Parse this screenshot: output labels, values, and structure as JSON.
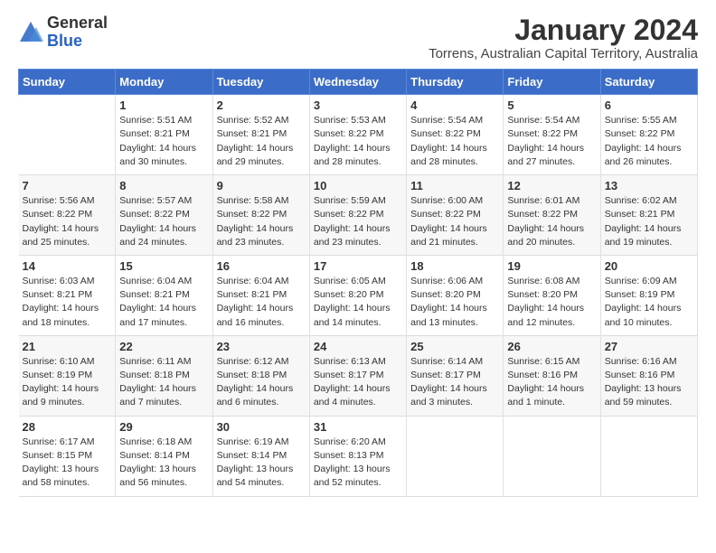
{
  "logo": {
    "general": "General",
    "blue": "Blue"
  },
  "header": {
    "title": "January 2024",
    "subtitle": "Torrens, Australian Capital Territory, Australia"
  },
  "calendar": {
    "days_of_week": [
      "Sunday",
      "Monday",
      "Tuesday",
      "Wednesday",
      "Thursday",
      "Friday",
      "Saturday"
    ],
    "weeks": [
      [
        {
          "day": "",
          "info": ""
        },
        {
          "day": "1",
          "info": "Sunrise: 5:51 AM\nSunset: 8:21 PM\nDaylight: 14 hours\nand 30 minutes."
        },
        {
          "day": "2",
          "info": "Sunrise: 5:52 AM\nSunset: 8:21 PM\nDaylight: 14 hours\nand 29 minutes."
        },
        {
          "day": "3",
          "info": "Sunrise: 5:53 AM\nSunset: 8:22 PM\nDaylight: 14 hours\nand 28 minutes."
        },
        {
          "day": "4",
          "info": "Sunrise: 5:54 AM\nSunset: 8:22 PM\nDaylight: 14 hours\nand 28 minutes."
        },
        {
          "day": "5",
          "info": "Sunrise: 5:54 AM\nSunset: 8:22 PM\nDaylight: 14 hours\nand 27 minutes."
        },
        {
          "day": "6",
          "info": "Sunrise: 5:55 AM\nSunset: 8:22 PM\nDaylight: 14 hours\nand 26 minutes."
        }
      ],
      [
        {
          "day": "7",
          "info": "Sunrise: 5:56 AM\nSunset: 8:22 PM\nDaylight: 14 hours\nand 25 minutes."
        },
        {
          "day": "8",
          "info": "Sunrise: 5:57 AM\nSunset: 8:22 PM\nDaylight: 14 hours\nand 24 minutes."
        },
        {
          "day": "9",
          "info": "Sunrise: 5:58 AM\nSunset: 8:22 PM\nDaylight: 14 hours\nand 23 minutes."
        },
        {
          "day": "10",
          "info": "Sunrise: 5:59 AM\nSunset: 8:22 PM\nDaylight: 14 hours\nand 23 minutes."
        },
        {
          "day": "11",
          "info": "Sunrise: 6:00 AM\nSunset: 8:22 PM\nDaylight: 14 hours\nand 21 minutes."
        },
        {
          "day": "12",
          "info": "Sunrise: 6:01 AM\nSunset: 8:22 PM\nDaylight: 14 hours\nand 20 minutes."
        },
        {
          "day": "13",
          "info": "Sunrise: 6:02 AM\nSunset: 8:21 PM\nDaylight: 14 hours\nand 19 minutes."
        }
      ],
      [
        {
          "day": "14",
          "info": "Sunrise: 6:03 AM\nSunset: 8:21 PM\nDaylight: 14 hours\nand 18 minutes."
        },
        {
          "day": "15",
          "info": "Sunrise: 6:04 AM\nSunset: 8:21 PM\nDaylight: 14 hours\nand 17 minutes."
        },
        {
          "day": "16",
          "info": "Sunrise: 6:04 AM\nSunset: 8:21 PM\nDaylight: 14 hours\nand 16 minutes."
        },
        {
          "day": "17",
          "info": "Sunrise: 6:05 AM\nSunset: 8:20 PM\nDaylight: 14 hours\nand 14 minutes."
        },
        {
          "day": "18",
          "info": "Sunrise: 6:06 AM\nSunset: 8:20 PM\nDaylight: 14 hours\nand 13 minutes."
        },
        {
          "day": "19",
          "info": "Sunrise: 6:08 AM\nSunset: 8:20 PM\nDaylight: 14 hours\nand 12 minutes."
        },
        {
          "day": "20",
          "info": "Sunrise: 6:09 AM\nSunset: 8:19 PM\nDaylight: 14 hours\nand 10 minutes."
        }
      ],
      [
        {
          "day": "21",
          "info": "Sunrise: 6:10 AM\nSunset: 8:19 PM\nDaylight: 14 hours\nand 9 minutes."
        },
        {
          "day": "22",
          "info": "Sunrise: 6:11 AM\nSunset: 8:18 PM\nDaylight: 14 hours\nand 7 minutes."
        },
        {
          "day": "23",
          "info": "Sunrise: 6:12 AM\nSunset: 8:18 PM\nDaylight: 14 hours\nand 6 minutes."
        },
        {
          "day": "24",
          "info": "Sunrise: 6:13 AM\nSunset: 8:17 PM\nDaylight: 14 hours\nand 4 minutes."
        },
        {
          "day": "25",
          "info": "Sunrise: 6:14 AM\nSunset: 8:17 PM\nDaylight: 14 hours\nand 3 minutes."
        },
        {
          "day": "26",
          "info": "Sunrise: 6:15 AM\nSunset: 8:16 PM\nDaylight: 14 hours\nand 1 minute."
        },
        {
          "day": "27",
          "info": "Sunrise: 6:16 AM\nSunset: 8:16 PM\nDaylight: 13 hours\nand 59 minutes."
        }
      ],
      [
        {
          "day": "28",
          "info": "Sunrise: 6:17 AM\nSunset: 8:15 PM\nDaylight: 13 hours\nand 58 minutes."
        },
        {
          "day": "29",
          "info": "Sunrise: 6:18 AM\nSunset: 8:14 PM\nDaylight: 13 hours\nand 56 minutes."
        },
        {
          "day": "30",
          "info": "Sunrise: 6:19 AM\nSunset: 8:14 PM\nDaylight: 13 hours\nand 54 minutes."
        },
        {
          "day": "31",
          "info": "Sunrise: 6:20 AM\nSunset: 8:13 PM\nDaylight: 13 hours\nand 52 minutes."
        },
        {
          "day": "",
          "info": ""
        },
        {
          "day": "",
          "info": ""
        },
        {
          "day": "",
          "info": ""
        }
      ]
    ]
  }
}
